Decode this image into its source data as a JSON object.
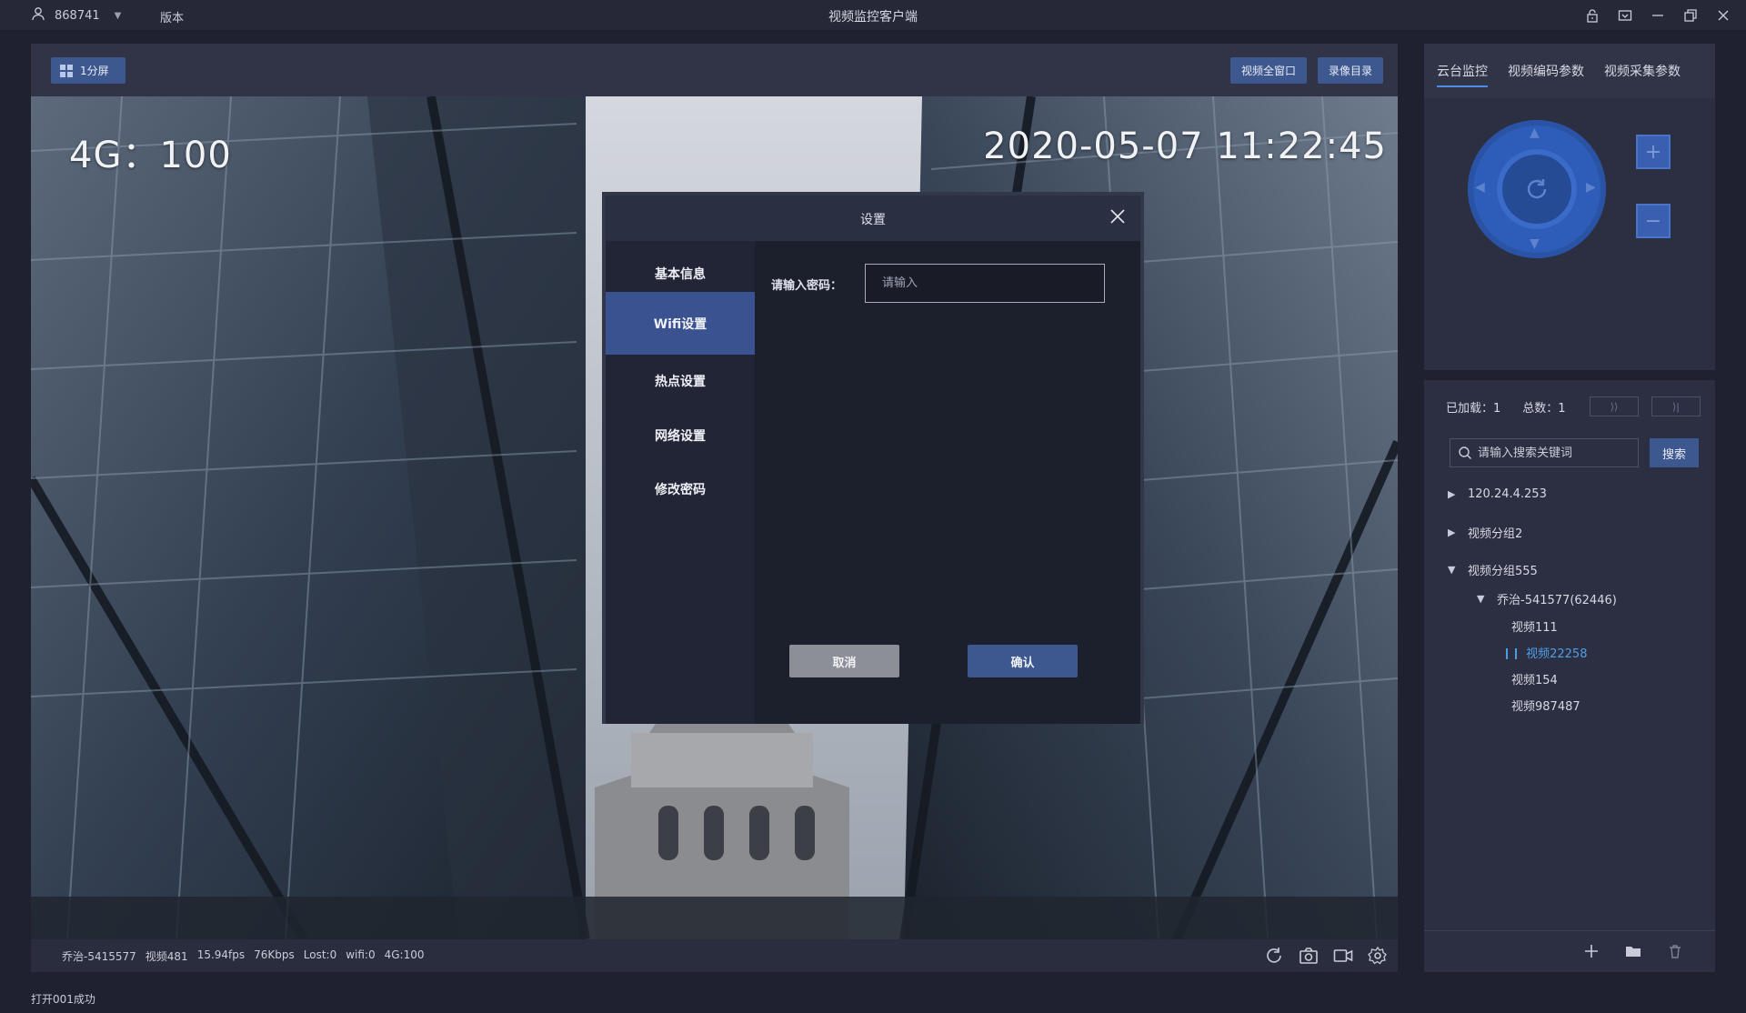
{
  "titlebar": {
    "user": "868741",
    "version_label": "版本",
    "title": "视频监控客户端"
  },
  "toolbar": {
    "split_label": "1分屏",
    "fullscreen_label": "视频全窗口",
    "record_dir_label": "录像目录"
  },
  "video": {
    "osd_signal": "4G：100",
    "osd_time": "2020-05-07 11:22:45"
  },
  "statusbar": {
    "items": [
      "乔治-5415577",
      "视频481",
      "15.94fps",
      "76Kbps",
      "Lost:0",
      "wifi:0",
      "4G:100"
    ]
  },
  "right_tabs": [
    "云台监控",
    "视频编码参数",
    "视频采集参数"
  ],
  "ptz": {
    "zoom_in": "+",
    "zoom_out": "−"
  },
  "tree": {
    "loaded_label": "已加载：1",
    "total_label": "总数：1",
    "next_label": "⟩⟩",
    "last_label": "⟩|",
    "search_placeholder": "请输入搜索关键词",
    "search_btn": "搜索",
    "items": [
      {
        "label": "120.24.4.253"
      },
      {
        "label": "视频分组2"
      },
      {
        "label": "视频分组555"
      },
      {
        "label": "乔治-541577(62446)"
      },
      {
        "label": "视频111"
      },
      {
        "label": "视频22258"
      },
      {
        "label": "视频154"
      },
      {
        "label": "视频987487"
      }
    ]
  },
  "bottom_status": "打开001成功",
  "modal": {
    "title": "设置",
    "nav": [
      "基本信息",
      "Wifi设置",
      "热点设置",
      "网络设置",
      "修改密码"
    ],
    "password_label": "请输入密码：",
    "password_placeholder": "请输入",
    "cancel": "取消",
    "confirm": "确认"
  }
}
